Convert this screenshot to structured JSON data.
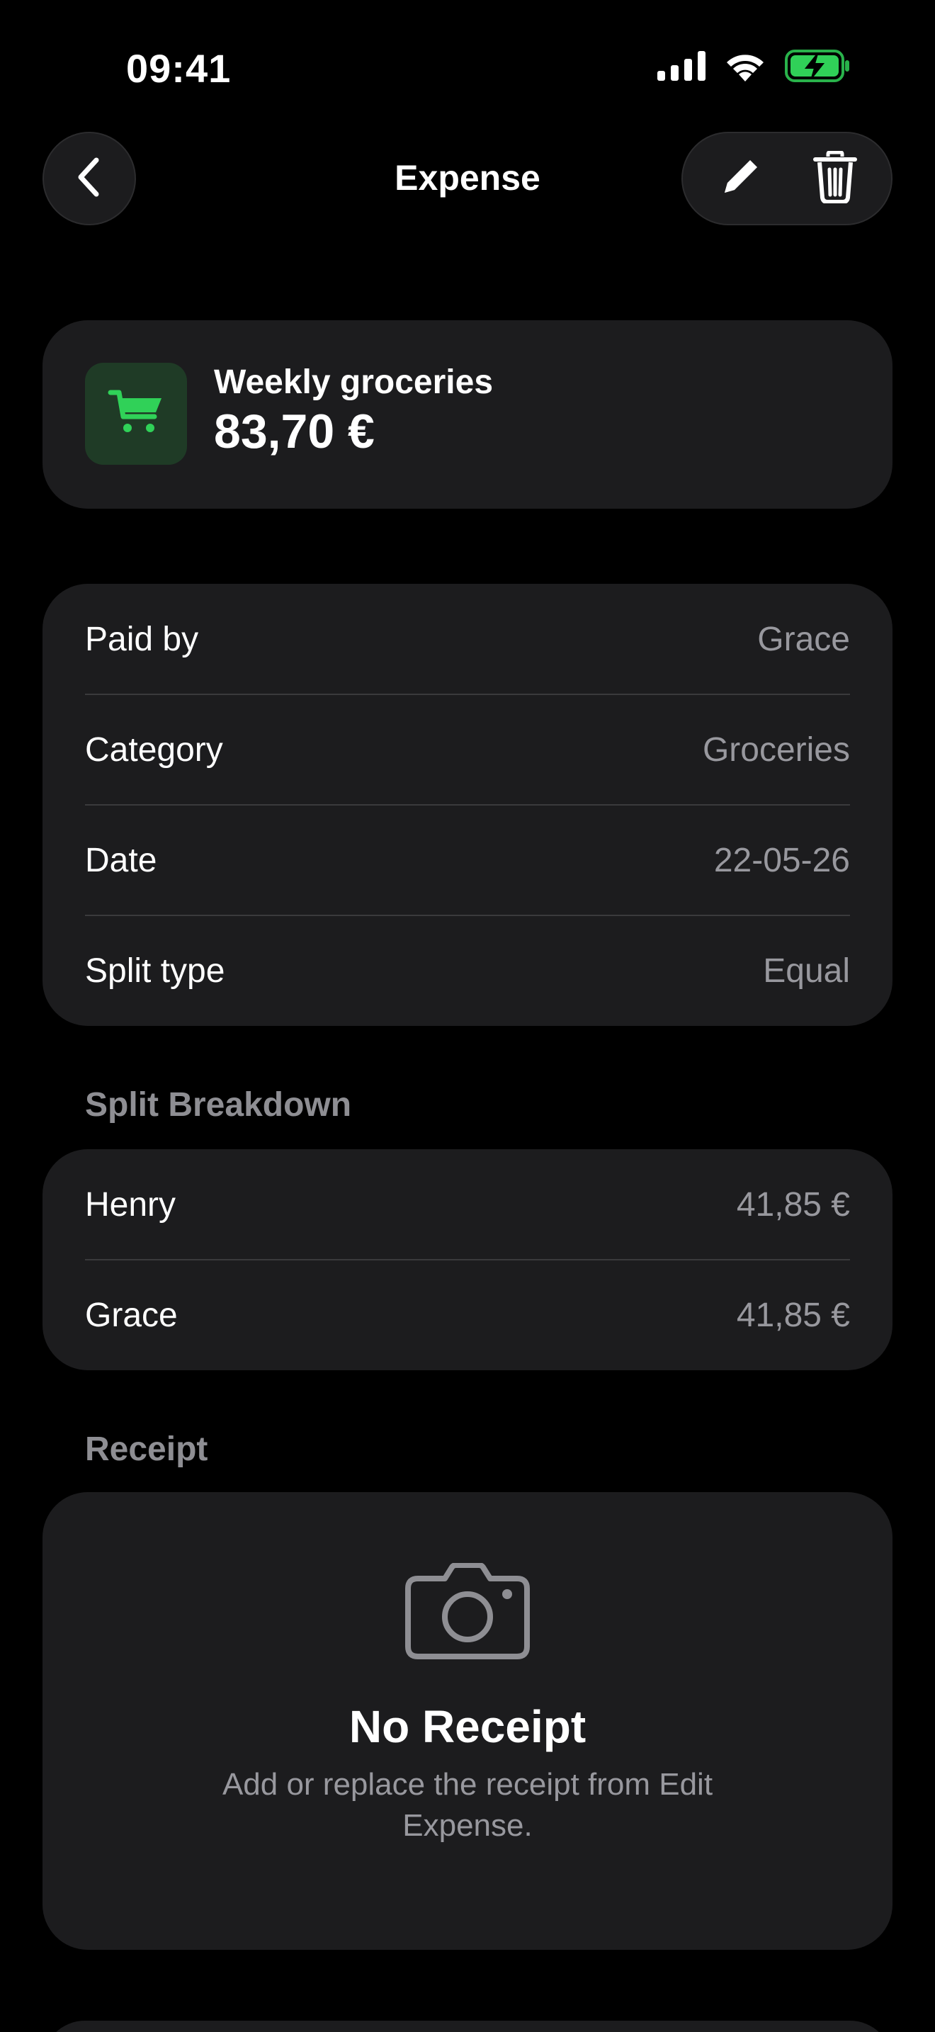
{
  "status_bar": {
    "time": "09:41",
    "icons": [
      "cellular-signal-icon",
      "wifi-icon",
      "battery-charging-icon"
    ],
    "battery_color": "#30d158"
  },
  "header": {
    "title": "Expense",
    "back_icon": "chevron-left-icon",
    "edit_icon": "pencil-icon",
    "delete_icon": "trash-icon"
  },
  "summary": {
    "icon": "shopping-cart-icon",
    "icon_color": "#30d158",
    "title": "Weekly groceries",
    "amount": "83,70 €"
  },
  "details": [
    {
      "label": "Paid by",
      "value": "Grace"
    },
    {
      "label": "Category",
      "value": "Groceries"
    },
    {
      "label": "Date",
      "value": "22-05-26"
    },
    {
      "label": "Split type",
      "value": "Equal"
    }
  ],
  "split_breakdown": {
    "header": "Split Breakdown",
    "rows": [
      {
        "name": "Henry",
        "amount": "41,85 €"
      },
      {
        "name": "Grace",
        "amount": "41,85 €"
      }
    ]
  },
  "receipt": {
    "header": "Receipt",
    "icon": "camera-icon",
    "title": "No Receipt",
    "description": "Add or replace the receipt from Edit Expense."
  }
}
